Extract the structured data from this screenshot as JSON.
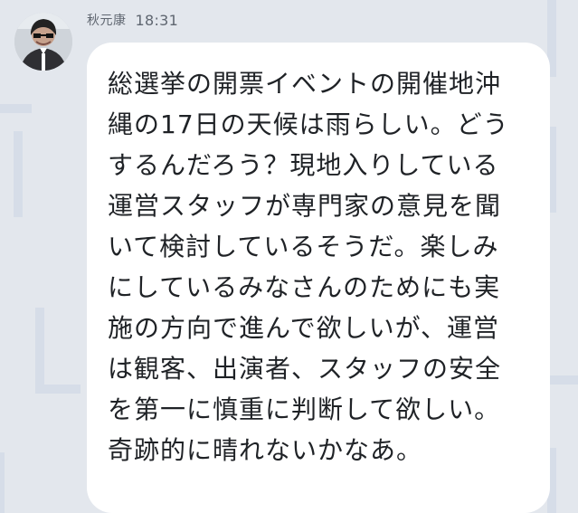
{
  "message": {
    "sender": "秋元康",
    "time": "18:31",
    "lines": [
      "総選挙の開票イベントの開催地沖",
      "縄の17日の天候は雨らしい。どう",
      "するんだろう？現地入りしている",
      "運営スタッフが専門家の意見を聞",
      "いて検討しているそうだ。楽しみ",
      "にしているみなさんのためにも実",
      "施の方向で進んで欲しいが、運営",
      "は観客、出演者、スタッフの安全",
      "を第一に慎重に判断して欲しい。",
      "奇跡的に晴れないかなあ。"
    ]
  },
  "theme": {
    "background": "#e3e7ed",
    "bubble": "#ffffff",
    "text": "#1f2226",
    "meta_text": "#5f6670",
    "pattern": "#d6dde8"
  },
  "icons": {
    "avatar": "profile-photo"
  }
}
